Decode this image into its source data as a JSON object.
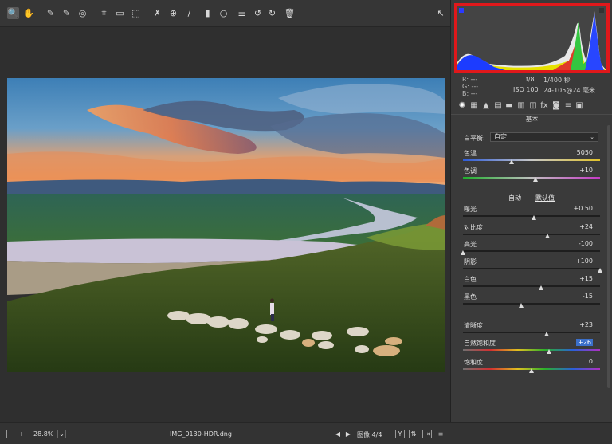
{
  "toolbar": {
    "tools": [
      {
        "name": "zoom-tool",
        "icon": "magnifier-icon",
        "glyph": "🔍",
        "active": true
      },
      {
        "name": "hand-tool",
        "icon": "hand-icon",
        "glyph": "✋"
      },
      {
        "name": "white-balance-tool",
        "icon": "eyedropper-icon",
        "glyph": "✎"
      },
      {
        "name": "color-sampler-tool",
        "icon": "sampler-icon",
        "glyph": "✎"
      },
      {
        "name": "targeted-adjustment-tool",
        "icon": "target-adjust-icon",
        "glyph": "◎"
      },
      {
        "name": "crop-tool",
        "icon": "crop-icon",
        "glyph": "⌗"
      },
      {
        "name": "straighten-tool",
        "icon": "straighten-icon",
        "glyph": "▭"
      },
      {
        "name": "transform-tool",
        "icon": "transform-icon",
        "glyph": "⬚"
      },
      {
        "name": "spot-removal-tool",
        "icon": "spot-removal-icon",
        "glyph": "✗"
      },
      {
        "name": "red-eye-tool",
        "icon": "red-eye-icon",
        "glyph": "⊕"
      },
      {
        "name": "adjustment-brush-tool",
        "icon": "brush-icon",
        "glyph": "/"
      },
      {
        "name": "graduated-filter-tool",
        "icon": "graduated-filter-icon",
        "glyph": "▮"
      },
      {
        "name": "radial-filter-tool",
        "icon": "radial-filter-icon",
        "glyph": "○"
      },
      {
        "name": "preferences-tool",
        "icon": "list-icon",
        "glyph": "☰"
      },
      {
        "name": "rotate-left-tool",
        "icon": "rotate-left-icon",
        "glyph": "↺"
      },
      {
        "name": "rotate-right-tool",
        "icon": "rotate-right-icon",
        "glyph": "↻"
      },
      {
        "name": "delete-tool",
        "icon": "trash-icon",
        "glyph": "🗑"
      }
    ],
    "fullscreen_glyph": "⇱"
  },
  "info": {
    "r": "R:  ---",
    "g": "G:  ---",
    "b": "B:  ---",
    "aperture": "f/8",
    "shutter": "1/400 秒",
    "iso": "ISO 100",
    "lens": "24-105@24 毫米"
  },
  "panel_tabs": [
    {
      "name": "tab-basic",
      "icon": "aperture-icon",
      "glyph": "✺"
    },
    {
      "name": "tab-tone-curve",
      "icon": "tone-curve-icon",
      "glyph": "▦"
    },
    {
      "name": "tab-detail",
      "icon": "detail-icon",
      "glyph": "▲"
    },
    {
      "name": "tab-hsl",
      "icon": "hsl-icon",
      "glyph": "▤"
    },
    {
      "name": "tab-split-toning",
      "icon": "split-toning-icon",
      "glyph": "▬"
    },
    {
      "name": "tab-lens",
      "icon": "lens-icon",
      "glyph": "▥"
    },
    {
      "name": "tab-transform",
      "icon": "transform-icon",
      "glyph": "◫"
    },
    {
      "name": "tab-effects",
      "icon": "effects-icon",
      "glyph": "fx"
    },
    {
      "name": "tab-camera-calibration",
      "icon": "camera-icon",
      "glyph": "◙"
    },
    {
      "name": "tab-presets",
      "icon": "presets-icon",
      "glyph": "≡"
    },
    {
      "name": "tab-snapshots",
      "icon": "snapshots-icon",
      "glyph": "▣"
    }
  ],
  "section_title": "基本",
  "white_balance": {
    "label": "白平衡:",
    "value": "自定"
  },
  "auto_label": "自动",
  "default_label": "默认值",
  "sliders": [
    {
      "key": "temp",
      "label": "色温",
      "value": "5050",
      "pos": 0.36,
      "gradient": "temp"
    },
    {
      "key": "tint",
      "label": "色调",
      "value": "+10",
      "pos": 0.53,
      "gradient": "tint"
    },
    {
      "key": "exposure",
      "label": "曝光",
      "value": "+0.50",
      "pos": 0.52
    },
    {
      "key": "contrast",
      "label": "对比度",
      "value": "+24",
      "pos": 0.62
    },
    {
      "key": "highlights",
      "label": "高光",
      "value": "-100",
      "pos": 0.0
    },
    {
      "key": "shadows",
      "label": "阴影",
      "value": "+100",
      "pos": 1.0
    },
    {
      "key": "whites",
      "label": "白色",
      "value": "+15",
      "pos": 0.575
    },
    {
      "key": "blacks",
      "label": "黑色",
      "value": "-15",
      "pos": 0.425
    },
    {
      "key": "clarity",
      "label": "清晰度",
      "value": "+23",
      "pos": 0.615
    },
    {
      "key": "vibrance",
      "label": "自然饱和度",
      "value": "+26",
      "pos": 0.63,
      "gradient": "sat",
      "highlight": true
    },
    {
      "key": "saturation",
      "label": "饱和度",
      "value": "0",
      "pos": 0.5,
      "gradient": "sat"
    }
  ],
  "footer": {
    "zoom": "28.8%",
    "filename": "IMG_0130-HDR.dng",
    "image_counter": "图像 4/4",
    "minus": "−",
    "plus": "+",
    "chevron": "⌄",
    "prev": "◀",
    "next": "▶",
    "y_label": "Y"
  },
  "colors": {
    "histogram_box": "#e0181b",
    "vibrance_highlight": "#3b6fc9"
  }
}
